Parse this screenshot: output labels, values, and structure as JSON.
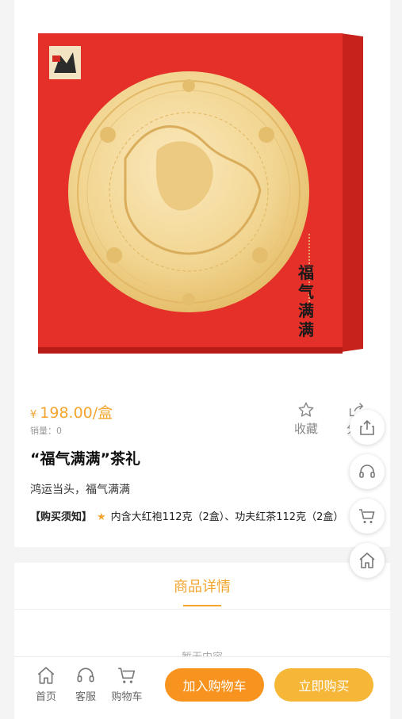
{
  "product": {
    "price_symbol": "¥",
    "price": "198.00/盒",
    "sales_label": "销量：0",
    "title": "“福气满满”茶礼",
    "subtitle": "鸿运当头，福气满满",
    "notice_tag": "【购买须知】",
    "notice_star": "★",
    "notice_text": "内含大红袍112克（2盒）、功夫红茶112克（2盒）",
    "box_caption": "福气满满"
  },
  "actions": {
    "favorite_label": "收藏",
    "share_label": "分享"
  },
  "tabs": {
    "detail_label": "商品详情"
  },
  "detail": {
    "empty_text": "暂无内容"
  },
  "bottom_nav": {
    "home": "首页",
    "service": "客服",
    "cart": "购物车",
    "add_to_cart": "加入购物车",
    "buy_now": "立即购买"
  },
  "colors": {
    "accent": "#f3a52f",
    "box_red": "#e5302a",
    "medallion_gold": "#f1d48f"
  }
}
